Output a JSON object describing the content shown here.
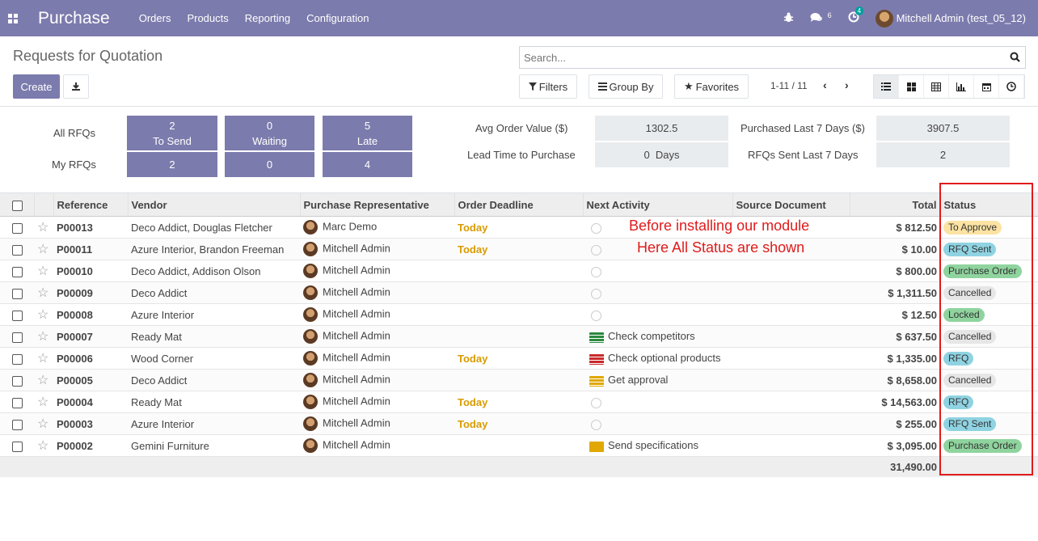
{
  "navbar": {
    "app_name": "Purchase",
    "menu": [
      "Orders",
      "Products",
      "Reporting",
      "Configuration"
    ],
    "messages_count": "6",
    "activities_count": "4",
    "user": "Mitchell Admin (test_05_12)"
  },
  "control_panel": {
    "title": "Requests for Quotation",
    "create_label": "Create",
    "search_placeholder": "Search...",
    "filters_label": "Filters",
    "groupby_label": "Group By",
    "favorites_label": "Favorites",
    "pager": "1-11 / 11"
  },
  "dashboard": {
    "all_rfqs_label": "All RFQs",
    "my_rfqs_label": "My RFQs",
    "tiles_all": [
      {
        "value": "2",
        "label": "To Send"
      },
      {
        "value": "0",
        "label": "Waiting"
      },
      {
        "value": "5",
        "label": "Late"
      }
    ],
    "tiles_my": [
      "2",
      "0",
      "4"
    ],
    "avg_order_label": "Avg Order Value ($)",
    "avg_order_value": "1302.5",
    "lead_time_label": "Lead Time to Purchase",
    "lead_time_value": "0  Days",
    "purchased_label": "Purchased Last 7 Days ($)",
    "purchased_value": "3907.5",
    "rfqs_sent_label": "RFQs Sent Last 7 Days",
    "rfqs_sent_value": "2"
  },
  "table": {
    "columns": [
      "Reference",
      "Vendor",
      "Purchase Representative",
      "Order Deadline",
      "Next Activity",
      "Source Document",
      "Total",
      "Status"
    ],
    "rows": [
      {
        "ref": "P00013",
        "vendor": "Deco Addict, Douglas Fletcher",
        "rep": "Marc Demo",
        "deadline": "Today",
        "activity": "",
        "activity_icon": "clock",
        "total": "$ 812.50",
        "status": "To Approve",
        "status_color": "#fce3a3"
      },
      {
        "ref": "P00011",
        "vendor": "Azure Interior, Brandon Freeman",
        "rep": "Mitchell Admin",
        "deadline": "Today",
        "activity": "",
        "activity_icon": "clock",
        "total": "$ 10.00",
        "status": "RFQ Sent",
        "status_color": "#8fd3e2"
      },
      {
        "ref": "P00010",
        "vendor": "Deco Addict, Addison Olson",
        "rep": "Mitchell Admin",
        "deadline": "",
        "activity": "",
        "activity_icon": "clock",
        "total": "$ 800.00",
        "status": "Purchase Order",
        "status_color": "#8fd49e"
      },
      {
        "ref": "P00009",
        "vendor": "Deco Addict",
        "rep": "Mitchell Admin",
        "deadline": "",
        "activity": "",
        "activity_icon": "clock",
        "total": "$ 1,311.50",
        "status": "Cancelled",
        "status_color": "#e6e6e6"
      },
      {
        "ref": "P00008",
        "vendor": "Azure Interior",
        "rep": "Mitchell Admin",
        "deadline": "",
        "activity": "",
        "activity_icon": "clock",
        "total": "$ 12.50",
        "status": "Locked",
        "status_color": "#8fd49e"
      },
      {
        "ref": "P00007",
        "vendor": "Ready Mat",
        "rep": "Mitchell Admin",
        "deadline": "",
        "activity": "Check competitors",
        "activity_icon": "green",
        "total": "$ 637.50",
        "status": "Cancelled",
        "status_color": "#e6e6e6"
      },
      {
        "ref": "P00006",
        "vendor": "Wood Corner",
        "rep": "Mitchell Admin",
        "deadline": "Today",
        "activity": "Check optional products",
        "activity_icon": "red",
        "total": "$ 1,335.00",
        "status": "RFQ",
        "status_color": "#8fd3e2"
      },
      {
        "ref": "P00005",
        "vendor": "Deco Addict",
        "rep": "Mitchell Admin",
        "deadline": "",
        "activity": "Get approval",
        "activity_icon": "yellow",
        "total": "$ 8,658.00",
        "status": "Cancelled",
        "status_color": "#e6e6e6"
      },
      {
        "ref": "P00004",
        "vendor": "Ready Mat",
        "rep": "Mitchell Admin",
        "deadline": "Today",
        "activity": "",
        "activity_icon": "clock",
        "total": "$ 14,563.00",
        "status": "RFQ",
        "status_color": "#8fd3e2"
      },
      {
        "ref": "P00003",
        "vendor": "Azure Interior",
        "rep": "Mitchell Admin",
        "deadline": "Today",
        "activity": "",
        "activity_icon": "clock",
        "total": "$ 255.00",
        "status": "RFQ Sent",
        "status_color": "#8fd3e2"
      },
      {
        "ref": "P00002",
        "vendor": "Gemini Furniture",
        "rep": "Mitchell Admin",
        "deadline": "",
        "activity": "Send specifications",
        "activity_icon": "mail",
        "total": "$ 3,095.00",
        "status": "Purchase Order",
        "status_color": "#8fd49e"
      }
    ],
    "grand_total": "31,490.00"
  },
  "annotation": {
    "line1": "Before installing our module",
    "line2": "Here All Status are shown",
    "color": "#e01b1b"
  }
}
